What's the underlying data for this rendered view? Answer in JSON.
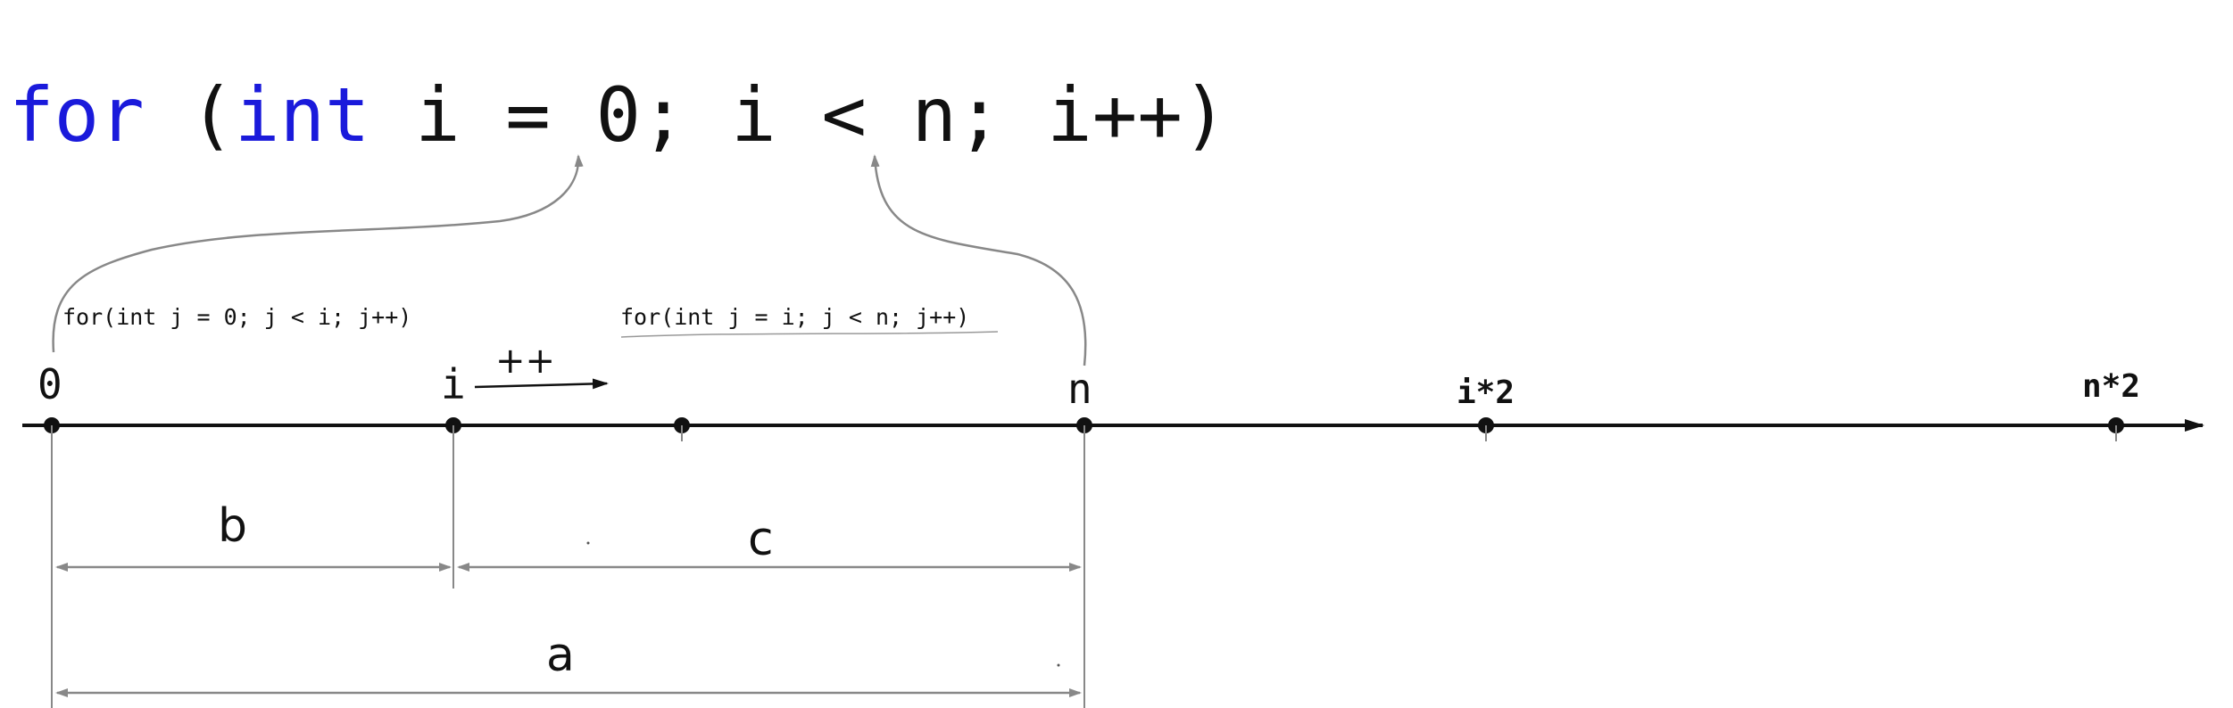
{
  "code_line": {
    "kw_for": "for",
    "paren_open": "(",
    "kw_int": "int",
    "rest": " i = 0; i < n; i++)"
  },
  "inner_loops": {
    "left": "for(int j = 0; j < i; j++)",
    "right": "for(int j = i; j < n; j++)"
  },
  "number_line": {
    "points": {
      "zero": "0",
      "i": "i",
      "n": "n",
      "i_times_2": "i*2",
      "n_times_2": "n*2"
    },
    "increment": "++"
  },
  "segments": {
    "b": "b",
    "c": "c",
    "a": "a"
  },
  "colors": {
    "keyword": "#1a1adb",
    "text": "#111111",
    "guide": "#888888"
  }
}
